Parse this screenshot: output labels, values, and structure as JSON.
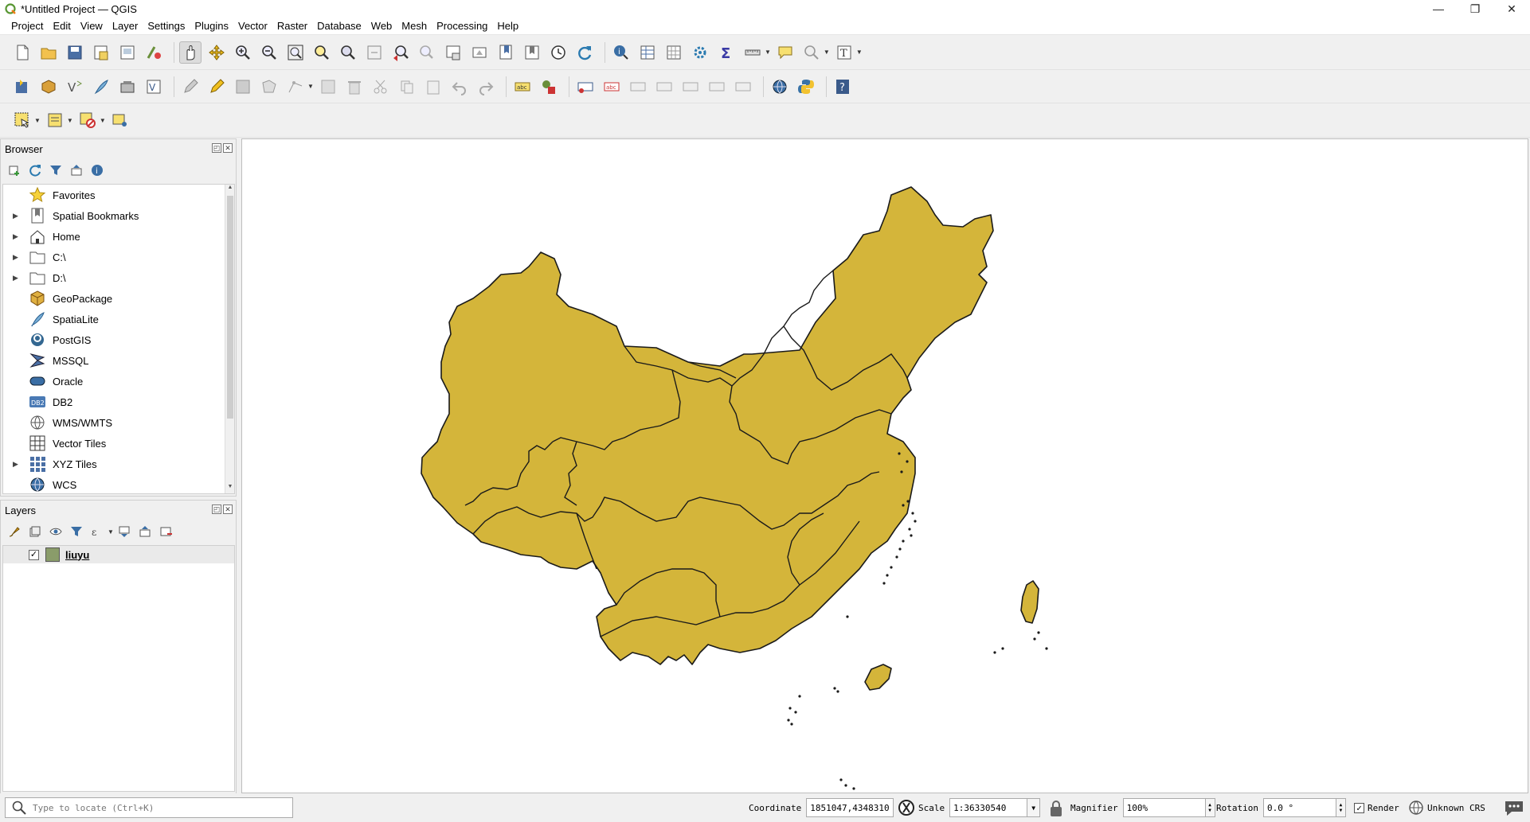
{
  "window": {
    "title": "*Untitled Project — QGIS",
    "minimize": "—",
    "maximize": "❐",
    "close": "✕"
  },
  "menu": [
    "Project",
    "Edit",
    "View",
    "Layer",
    "Settings",
    "Plugins",
    "Vector",
    "Raster",
    "Database",
    "Web",
    "Mesh",
    "Processing",
    "Help"
  ],
  "browser": {
    "title": "Browser",
    "items": [
      {
        "label": "Favorites",
        "icon": "star-icon",
        "expandable": false
      },
      {
        "label": "Spatial Bookmarks",
        "icon": "bookmark-icon",
        "expandable": true
      },
      {
        "label": "Home",
        "icon": "home-icon",
        "expandable": true
      },
      {
        "label": "C:\\",
        "icon": "folder-icon",
        "expandable": true
      },
      {
        "label": "D:\\",
        "icon": "folder-icon",
        "expandable": true
      },
      {
        "label": "GeoPackage",
        "icon": "geopackage-icon",
        "expandable": false
      },
      {
        "label": "SpatiaLite",
        "icon": "spatialite-icon",
        "expandable": false
      },
      {
        "label": "PostGIS",
        "icon": "postgis-icon",
        "expandable": false
      },
      {
        "label": "MSSQL",
        "icon": "mssql-icon",
        "expandable": false
      },
      {
        "label": "Oracle",
        "icon": "oracle-icon",
        "expandable": false
      },
      {
        "label": "DB2",
        "icon": "db2-icon",
        "expandable": false
      },
      {
        "label": "WMS/WMTS",
        "icon": "wms-icon",
        "expandable": false
      },
      {
        "label": "Vector Tiles",
        "icon": "vector-tiles-icon",
        "expandable": false
      },
      {
        "label": "XYZ Tiles",
        "icon": "xyz-tiles-icon",
        "expandable": true
      },
      {
        "label": "WCS",
        "icon": "wcs-icon",
        "expandable": false
      }
    ]
  },
  "layers": {
    "title": "Layers",
    "items": [
      {
        "name": "liuyu",
        "checked": true,
        "swatch": "#8a9c6a"
      }
    ]
  },
  "map": {
    "fill": "#d4b53a",
    "stroke": "#1a1a1a"
  },
  "status": {
    "locator_placeholder": "Type to locate (Ctrl+K)",
    "coordinate_label": "Coordinate",
    "coordinate_value": "1851047,4348310",
    "scale_label": "Scale",
    "scale_value": "1:36330540",
    "magnifier_label": "Magnifier",
    "magnifier_value": "100%",
    "rotation_label": "Rotation",
    "rotation_value": "0.0 °",
    "render_label": "Render",
    "crs_label": "Unknown CRS"
  }
}
